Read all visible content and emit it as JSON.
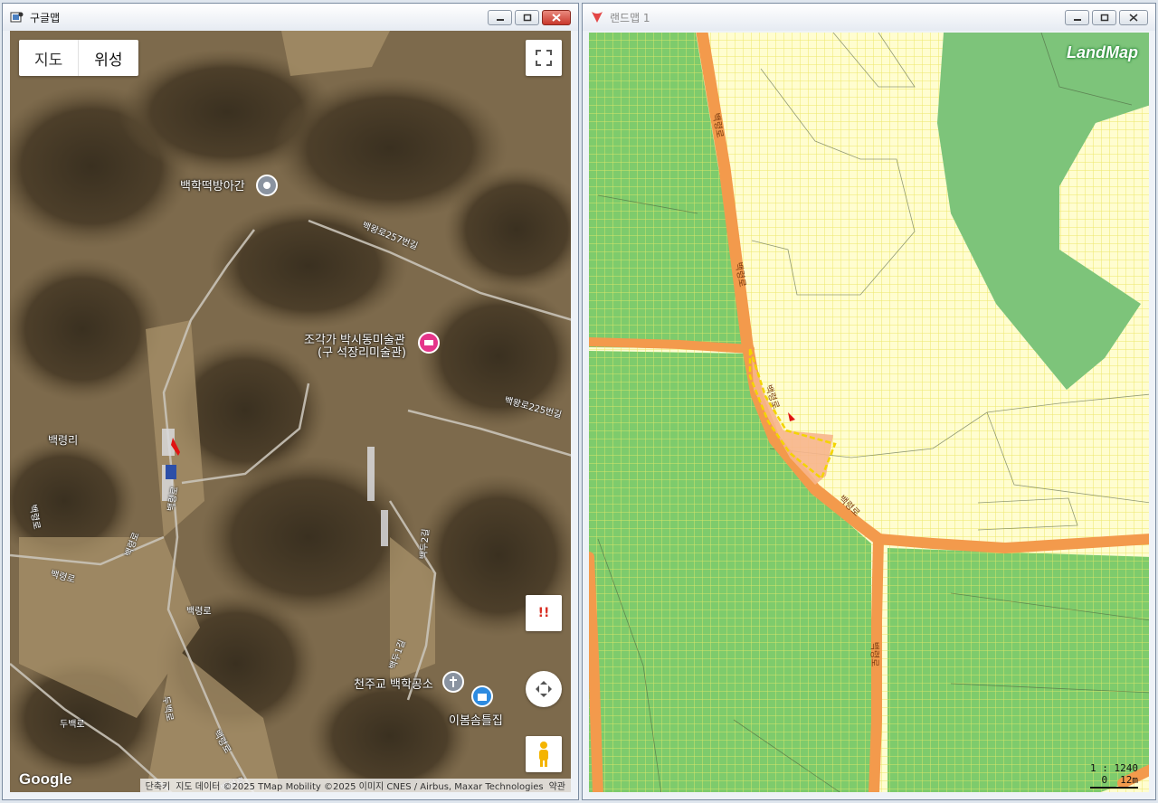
{
  "left_window": {
    "title": "구글맵",
    "map_type": {
      "map": "지도",
      "satellite": "위성",
      "selected": "위성"
    },
    "places": [
      "백학떡방아간",
      "조각가 박시동미술관",
      "(구 석장리미술관)",
      "천주교 백학공소",
      "이봄솜틀집"
    ],
    "villages": [
      "백령리"
    ],
    "roads": [
      "백왕로257번길",
      "백왕로225번길",
      "백령로",
      "백령로",
      "백령로",
      "백령로",
      "백령로",
      "백두2길",
      "백두1길",
      "두백로",
      "두백로",
      "백령로",
      "백왕로"
    ],
    "alert_symbol": "!!",
    "google_logo": "Google",
    "attribution": {
      "shortcuts": "단축키",
      "data": "지도 데이터 ©2025 TMap Mobility ©2025 이미지 CNES / Airbus, Maxar Technologies",
      "terms": "약관"
    },
    "icons": [
      "fullscreen-icon",
      "pin-icon",
      "museum-icon",
      "church-icon",
      "shop-icon",
      "move-icon",
      "pegman-icon"
    ]
  },
  "right_window": {
    "title": "랜드맵 1",
    "logo": "LandMap",
    "roads": [
      "백령로",
      "백령로",
      "백령로",
      "백령로",
      "백령로"
    ],
    "scale_ratio": "1 : 1240",
    "scale_ticks": [
      "0",
      "12m"
    ],
    "colors": {
      "green_zone": "#7ecb6c",
      "yellow_zone": "#fefcc4",
      "road": "#f39a4c",
      "parcel_fill": "#f7b58c",
      "parcel_border": "#f4d400"
    }
  }
}
